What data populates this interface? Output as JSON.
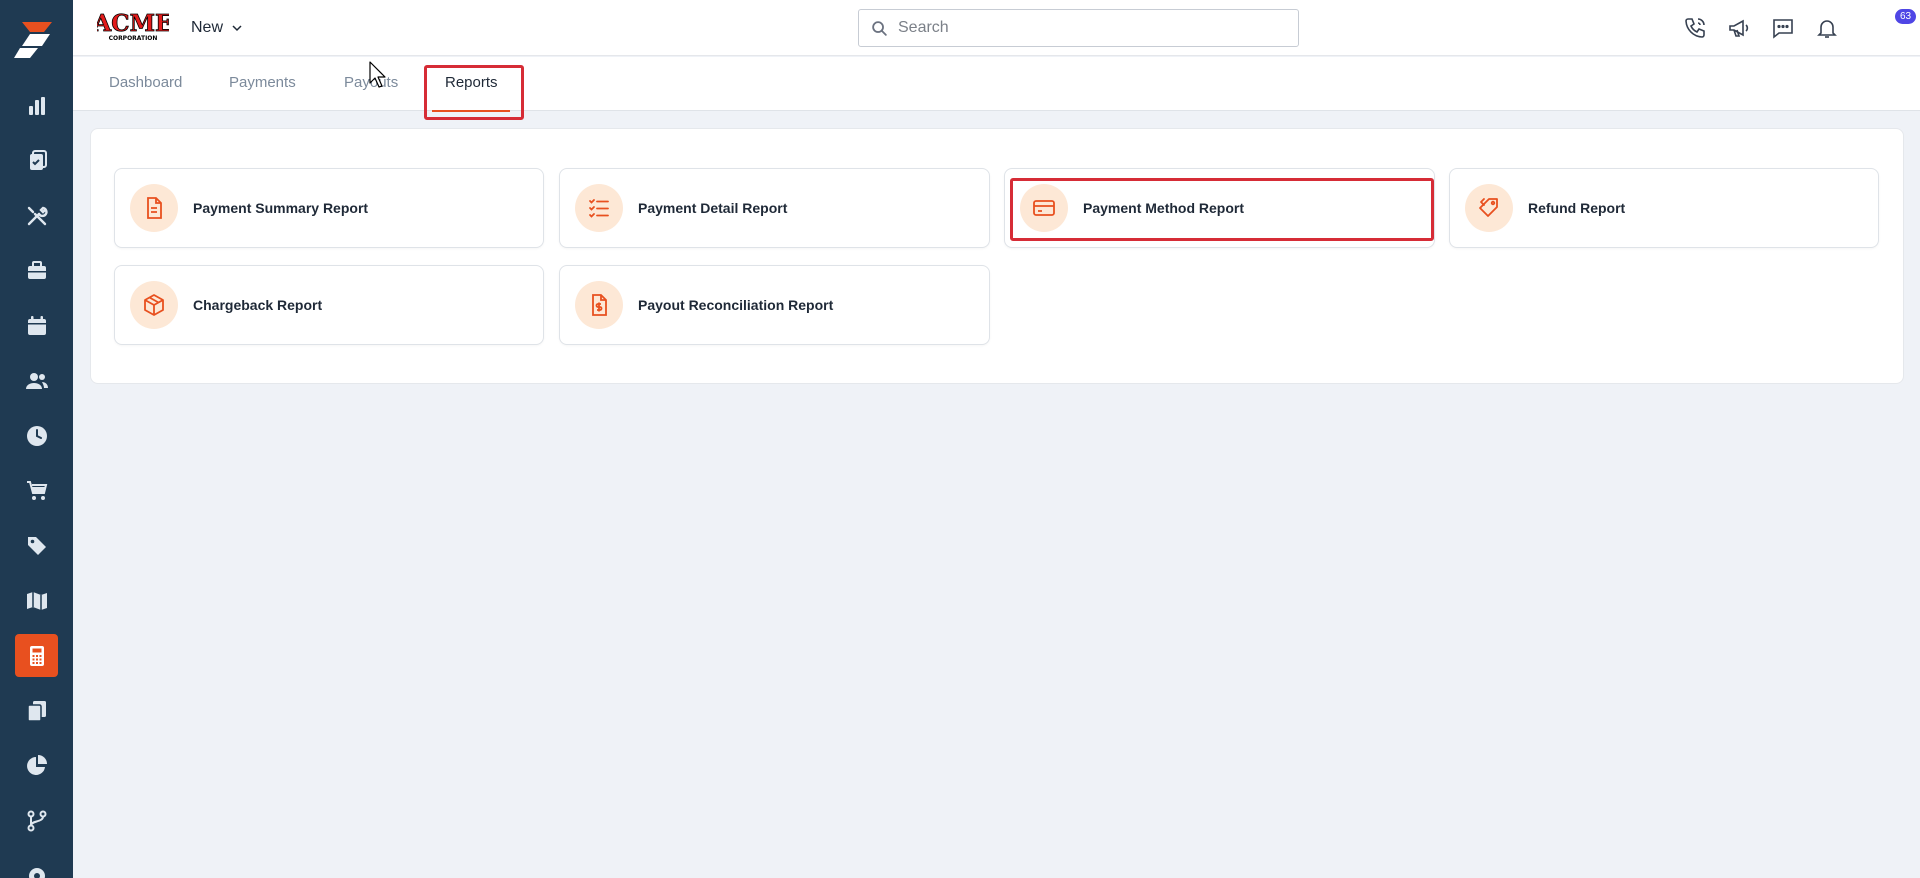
{
  "brand": {
    "logo_text": "ACME",
    "logo_subtext": "CORPORATION"
  },
  "header": {
    "new_label": "New",
    "search_placeholder": "Search",
    "notification_count": "63"
  },
  "tabs": [
    {
      "label": "Dashboard",
      "active": false
    },
    {
      "label": "Payments",
      "active": false
    },
    {
      "label": "Payouts",
      "active": false
    },
    {
      "label": "Reports",
      "active": true
    }
  ],
  "reports": [
    {
      "label": "Payment Summary Report",
      "icon": "document-icon"
    },
    {
      "label": "Payment Detail Report",
      "icon": "checklist-icon"
    },
    {
      "label": "Payment Method Report",
      "icon": "credit-card-icon"
    },
    {
      "label": "Refund Report",
      "icon": "tag-refund-icon"
    },
    {
      "label": "Chargeback Report",
      "icon": "box-icon"
    },
    {
      "label": "Payout Reconciliation Report",
      "icon": "dollar-document-icon"
    }
  ],
  "sidebar": {
    "items": [
      {
        "icon": "bar-chart-icon",
        "active": false
      },
      {
        "icon": "clipboard-icon",
        "active": false
      },
      {
        "icon": "tools-icon",
        "active": false
      },
      {
        "icon": "briefcase-icon",
        "active": false
      },
      {
        "icon": "calendar-icon",
        "active": false
      },
      {
        "icon": "users-icon",
        "active": false
      },
      {
        "icon": "clock-icon",
        "active": false
      },
      {
        "icon": "cart-icon",
        "active": false
      },
      {
        "icon": "tag-icon",
        "active": false
      },
      {
        "icon": "map-icon",
        "active": false
      },
      {
        "icon": "calculator-icon",
        "active": true
      },
      {
        "icon": "files-icon",
        "active": false
      },
      {
        "icon": "pie-chart-icon",
        "active": false
      },
      {
        "icon": "workflow-icon",
        "active": false
      },
      {
        "icon": "settings-icon",
        "active": false
      }
    ]
  },
  "colors": {
    "accent": "#e8501f",
    "sidebar_bg": "#1f3a52",
    "highlight": "#d62c36",
    "icon_bg": "#fde8d6"
  }
}
